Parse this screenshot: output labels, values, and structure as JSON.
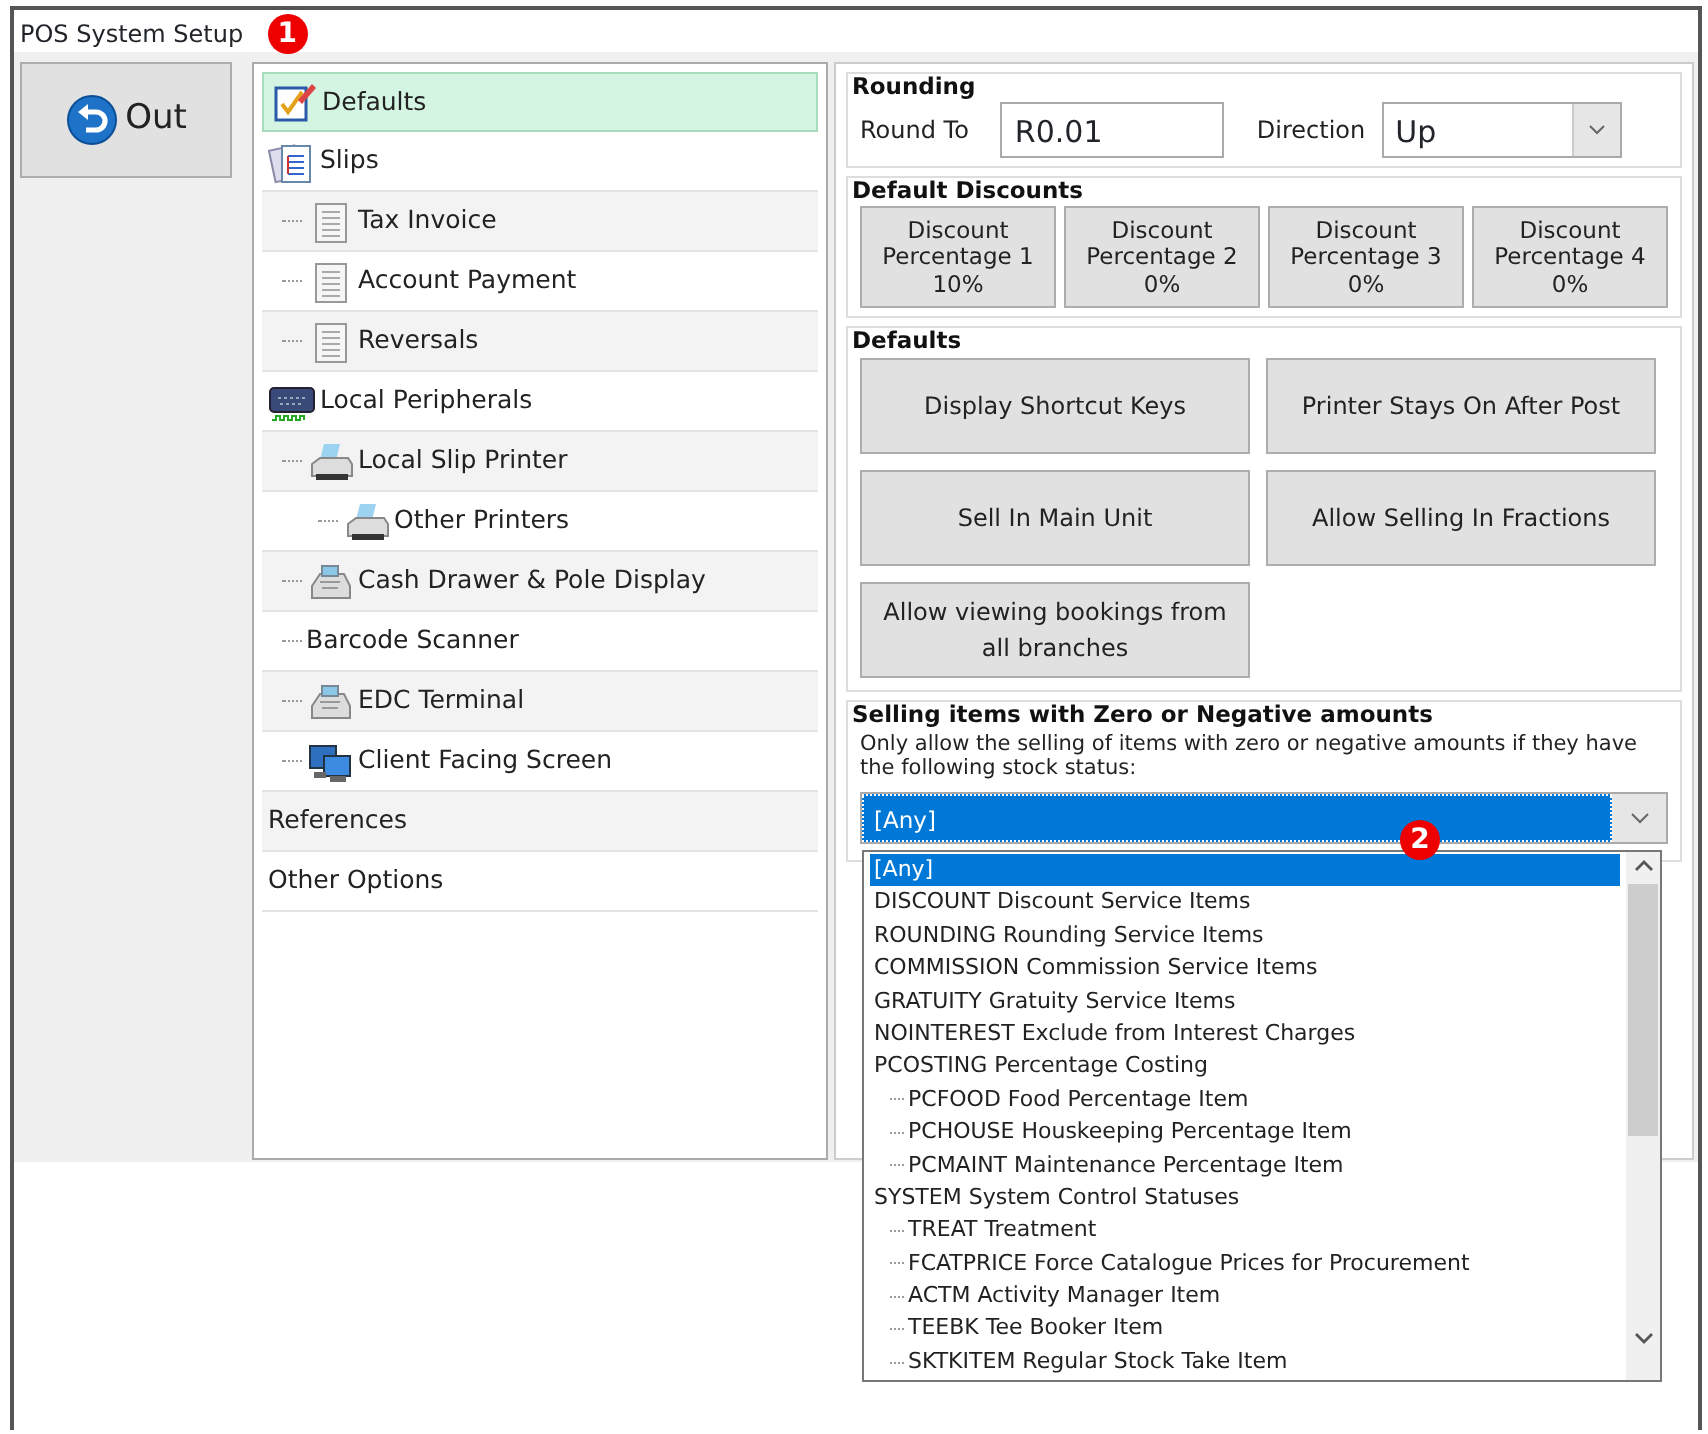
{
  "window": {
    "title": "POS System Setup"
  },
  "callouts": [
    {
      "label": "1"
    },
    {
      "label": "2"
    }
  ],
  "out_button": {
    "label": "Out"
  },
  "tree": [
    {
      "label": "Defaults",
      "selected": true
    },
    {
      "label": "Slips",
      "selected": false,
      "children": [
        {
          "label": "Tax Invoice",
          "selected": false
        },
        {
          "label": "Account Payment",
          "selected": false
        },
        {
          "label": "Reversals",
          "selected": false
        }
      ]
    },
    {
      "label": "Local Peripherals",
      "selected": false,
      "children": [
        {
          "label": "Local Slip Printer",
          "selected": false,
          "children": [
            {
              "label": "Other Printers",
              "selected": false
            }
          ]
        },
        {
          "label": "Cash Drawer & Pole Display",
          "selected": false
        },
        {
          "label": "Barcode Scanner",
          "selected": false
        },
        {
          "label": "EDC Terminal",
          "selected": false
        },
        {
          "label": "Client Facing Screen",
          "selected": false
        }
      ]
    },
    {
      "label": "References",
      "selected": false
    },
    {
      "label": "Other Options",
      "selected": false
    }
  ],
  "rounding": {
    "title": "Rounding",
    "round_to_label": "Round To",
    "round_to_value": "R0.01",
    "direction_label": "Direction",
    "direction_value": "Up"
  },
  "default_discounts": {
    "title": "Default Discounts",
    "buttons": [
      {
        "label": "Discount Percentage 1",
        "value": "10%"
      },
      {
        "label": "Discount Percentage 2",
        "value": "0%"
      },
      {
        "label": "Discount Percentage 3",
        "value": "0%"
      },
      {
        "label": "Discount Percentage 4",
        "value": "0%"
      }
    ]
  },
  "defaults": {
    "title": "Defaults",
    "buttons": [
      "Display Shortcut Keys",
      "Printer Stays On After Post",
      "Sell In Main Unit",
      "Allow Selling In Fractions",
      "Allow viewing bookings from all branches"
    ]
  },
  "selling": {
    "title": "Selling items with Zero or Negative amounts",
    "description": "Only allow the selling of items with zero or negative amounts if they have the following stock status:",
    "value": "[Any]",
    "expanded": true,
    "options": [
      {
        "label": "[Any]",
        "selected": true
      },
      {
        "label": "DISCOUNT Discount Service Items",
        "selected": false
      },
      {
        "label": "ROUNDING Rounding Service Items",
        "selected": false
      },
      {
        "label": "COMMISSION Commission Service Items",
        "selected": false
      },
      {
        "label": "GRATUITY Gratuity Service Items",
        "selected": false
      },
      {
        "label": "NOINTEREST Exclude from Interest Charges",
        "selected": false
      },
      {
        "label": "PCOSTING Percentage Costing",
        "selected": false,
        "children": [
          {
            "label": "PCFOOD Food Percentage Item",
            "selected": false
          },
          {
            "label": "PCHOUSE Houskeeping Percentage Item",
            "selected": false
          },
          {
            "label": "PCMAINT Maintenance Percentage Item",
            "selected": false
          }
        ]
      },
      {
        "label": "SYSTEM System Control Statuses",
        "selected": false,
        "children": [
          {
            "label": "TREAT Treatment",
            "selected": false
          },
          {
            "label": "FCATPRICE Force Catalogue Prices for Procurement",
            "selected": false
          },
          {
            "label": "ACTM Activity Manager Item",
            "selected": false
          },
          {
            "label": "TEEBK Tee Booker Item",
            "selected": false
          },
          {
            "label": "SKTKITEM Regular Stock Take Item",
            "selected": false
          }
        ]
      }
    ]
  }
}
